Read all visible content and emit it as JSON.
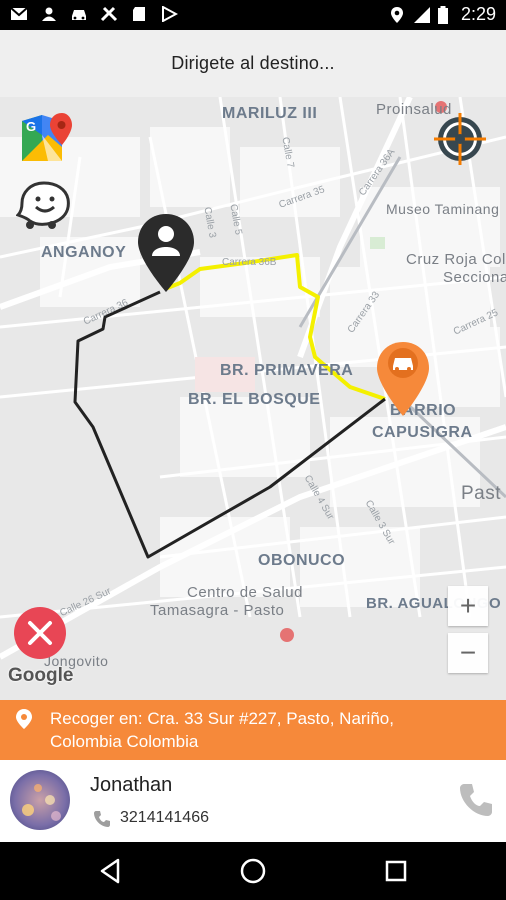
{
  "status_bar": {
    "time": "2:29"
  },
  "header": {
    "title": "Dirigete al destino..."
  },
  "map": {
    "labels": {
      "mariluz": "MARILUZ III",
      "proinsalud": "Proinsalud",
      "anganoy": "ANGANOY",
      "museo": "Museo Taminang",
      "cruzroja": "Cruz Roja Colo",
      "seccional": "Seccional",
      "primavera": "BR. PRIMAVERA",
      "bosque": "BR. EL BOSQUE",
      "barrio": "BARRIO",
      "capusigra": "CAPUSIGRA",
      "pasto": "Past",
      "obonuco": "OBONUCO",
      "centro_salud": "Centro de Salud",
      "tamasagra": "Tamasagra - Pasto",
      "agualongo": "BR. AGUALONGO",
      "jongovito": "Jongovito",
      "google": "Google"
    },
    "streets": {
      "calle7": "Calle 7",
      "carrera35": "Carrera 35",
      "carrera36a": "Carrera 36A",
      "calle3": "Calle 3",
      "calle5": "Calle 5",
      "carrera36b": "Carrera 36B",
      "carrera33": "Carrera 33",
      "carrera25": "Carrera 25",
      "calle4sur": "Calle 4 Sur",
      "calle3sur": "Calle 3 Sur",
      "calle26sur": "Calle 26 Sur",
      "carrera36": "Carrera 36"
    },
    "zoom_in": "+",
    "zoom_out": "−"
  },
  "pickup": {
    "line1": "Recoger en: Cra. 33 Sur #227, Pasto, Nariño,",
    "line2": "Colombia  Colombia"
  },
  "driver": {
    "name": "Jonathan",
    "phone": "3214141466"
  },
  "colors": {
    "accent_orange": "#f6893a",
    "route_yellow": "#f4f000",
    "route_black": "#222222"
  }
}
